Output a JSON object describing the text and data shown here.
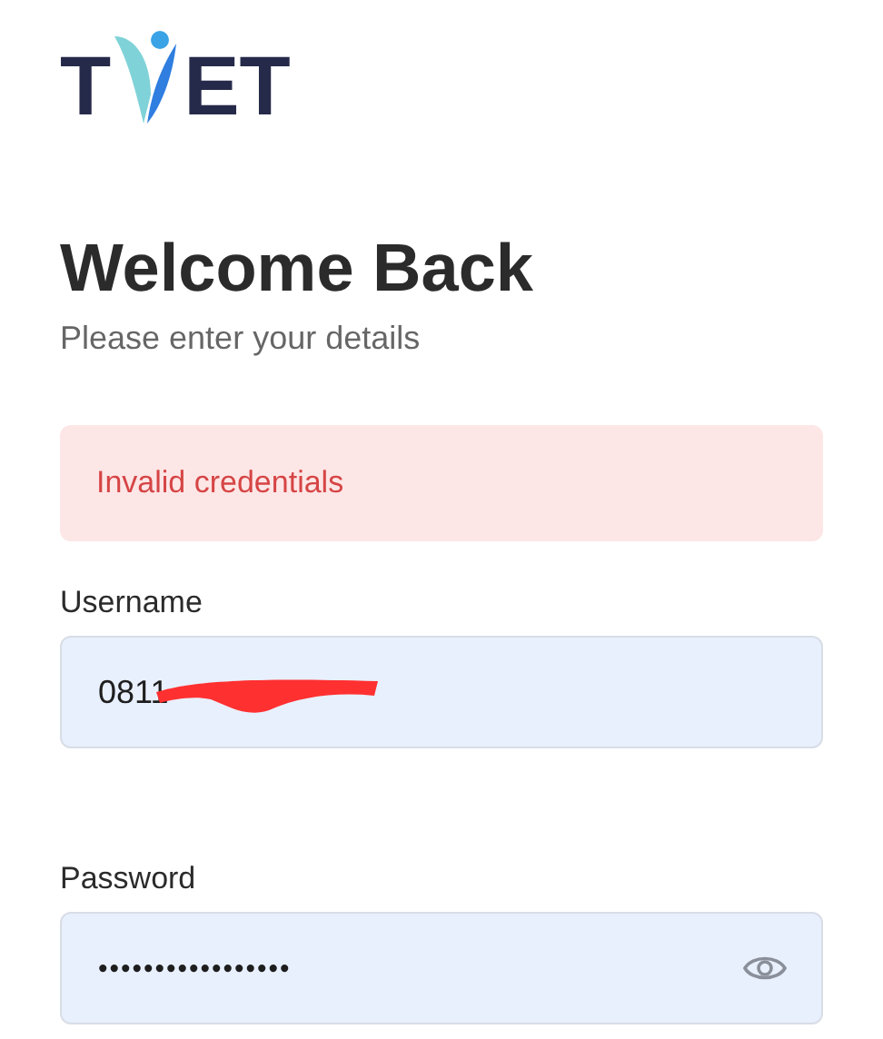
{
  "logo": {
    "left": "T",
    "right": "ET"
  },
  "heading": "Welcome Back",
  "subheading": "Please enter your details",
  "alert": {
    "message": "Invalid credentials"
  },
  "fields": [
    {
      "label": "Username",
      "value": "0811",
      "kind": "text",
      "redacted": true
    },
    {
      "label": "Password",
      "value": "•••••••••••••••••",
      "kind": "password"
    }
  ]
}
